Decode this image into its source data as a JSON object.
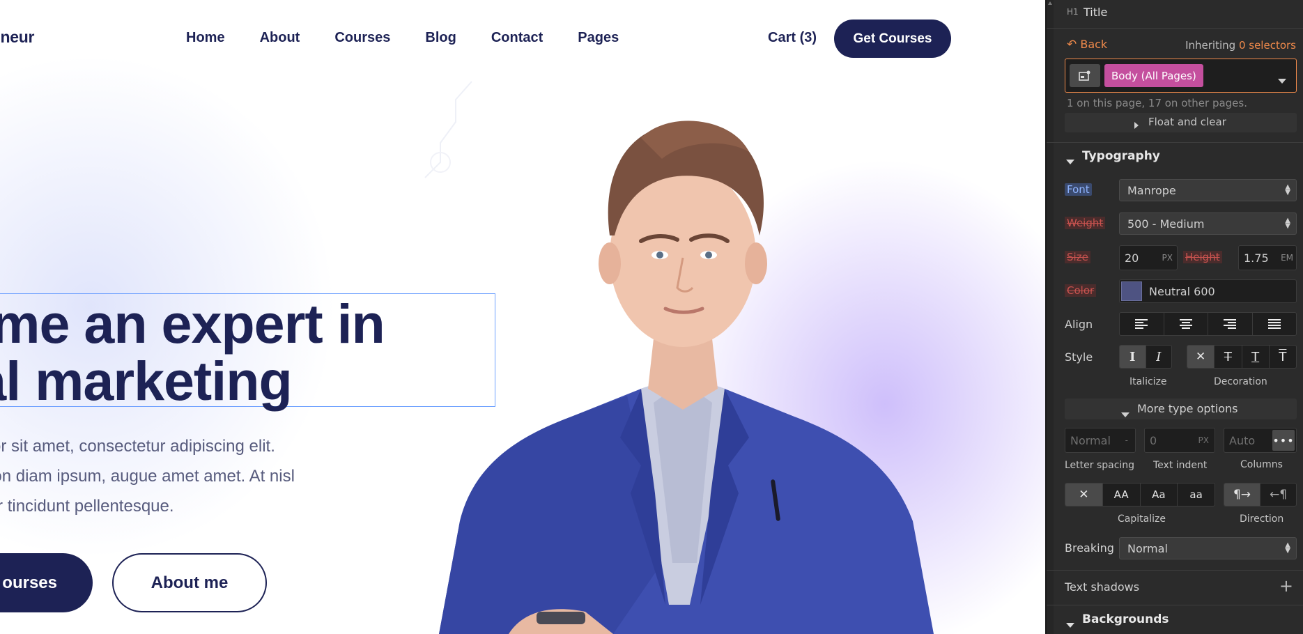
{
  "site": {
    "brand": "eneur",
    "nav": [
      "Home",
      "About",
      "Courses",
      "Blog",
      "Contact",
      "Pages"
    ],
    "cart": "Cart (3)",
    "cta": "Get Courses",
    "hero_title_lines": [
      "ome an expert in",
      "tal marketing"
    ],
    "hero_desc_lines": [
      "dolor sit amet, consectetur adipiscing elit.",
      "e non diam ipsum, augue amet amet. At nisl",
      "tetur tincidunt pellentesque."
    ],
    "btn_primary": "ourses",
    "btn_secondary": "About me",
    "colors": {
      "navy": "#1d2255",
      "suit_blue": "#3e4fb0",
      "selection_outline": "#6ea0ff"
    }
  },
  "panel": {
    "element_tag": "H1",
    "element_name": "Title",
    "back_label": "Back",
    "inheriting_label": "Inheriting",
    "inheriting_count": "0 selectors",
    "selector_chip": "Body (All Pages)",
    "selector_note": "1 on this page, 17 on other pages.",
    "float_label": "Float and clear",
    "typography_label": "Typography",
    "font_label": "Font",
    "font_value": "Manrope",
    "weight_label": "Weight",
    "weight_value": "500 - Medium",
    "size_label": "Size",
    "size_value": "20",
    "size_unit": "PX",
    "height_label": "Height",
    "height_value": "1.75",
    "height_unit": "EM",
    "color_label": "Color",
    "color_value": "Neutral 600",
    "color_swatch": "#4e5382",
    "align_label": "Align",
    "style_label": "Style",
    "italicize_label": "Italicize",
    "decoration_label": "Decoration",
    "more_type_label": "More type options",
    "letter_spacing_placeholder": "Normal",
    "letter_spacing_unit": "-",
    "text_indent_placeholder": "0",
    "text_indent_unit": "PX",
    "columns_placeholder": "Auto",
    "letter_spacing_label": "Letter spacing",
    "text_indent_label": "Text indent",
    "columns_label": "Columns",
    "capitalize_label": "Capitalize",
    "direction_label": "Direction",
    "breaking_label": "Breaking",
    "breaking_value": "Normal",
    "text_shadows_label": "Text shadows",
    "backgrounds_label": "Backgrounds",
    "accent_orange": "#f08a4b",
    "chip_pink": "#c44f9e"
  }
}
